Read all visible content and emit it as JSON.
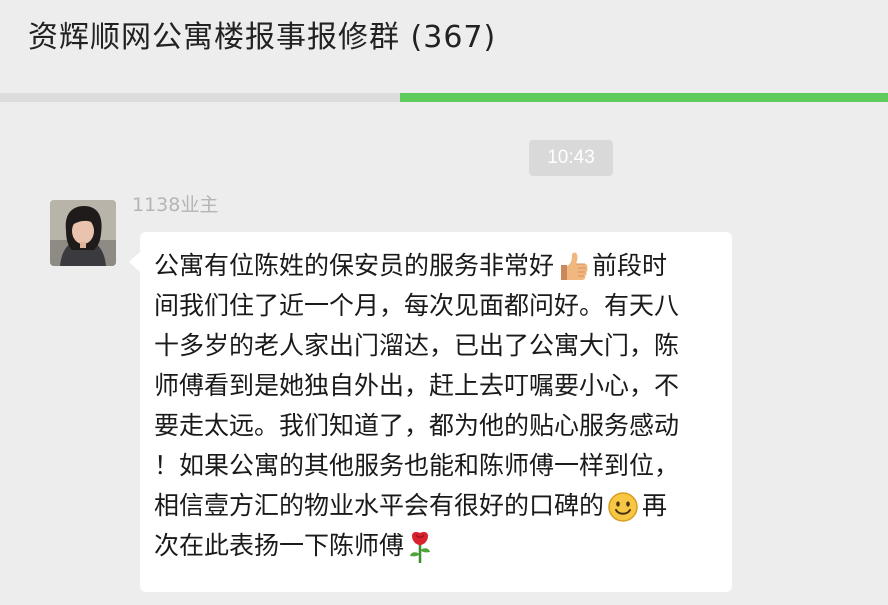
{
  "header": {
    "title": "资辉顺网公寓楼报事报修群 (367)"
  },
  "progress": {
    "fraction": 0.55,
    "color": "#5ecb5c"
  },
  "chat": {
    "timestamp": "10:43",
    "message": {
      "sender": "1138业主",
      "avatar_icon": "profile-photo",
      "lines": [
        "公寓有位陈姓的保安员的服务非常好",
        "前段时",
        "间我们住了近一个月，每次见面都问好。有天八",
        "十多岁的老人家出门溜达，已出了公寓大门，陈",
        "师傅看到是她独自外出，赶上去叮嘱要小心，不",
        "要走太远。我们知道了，都为他的贴心服务感动",
        "！如果公寓的其他服务也能和陈师傅一样到位，",
        "相信壹方汇的物业水平会有很好的口碑的",
        "再",
        "次在此表扬一下陈师傅"
      ],
      "emojis": {
        "first": "thumbs-up",
        "second": "smile",
        "third": "rose"
      }
    }
  }
}
